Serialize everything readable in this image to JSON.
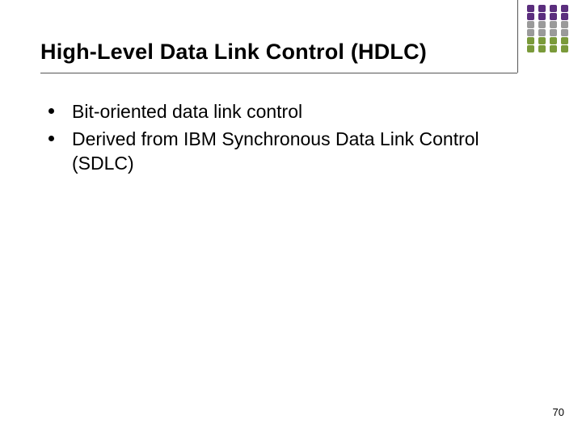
{
  "title": "High-Level Data Link Control (HDLC)",
  "bullets": [
    "Bit-oriented data link control",
    "Derived from IBM Synchronous Data Link Control (SDLC)"
  ],
  "page_number": "70",
  "decor": {
    "dot_colors_by_row": [
      "#5b2e7e",
      "#5b2e7e",
      "#9a9a9a",
      "#9a9a9a",
      "#7a9a3a",
      "#7a9a3a"
    ],
    "rows": 6,
    "cols": 4
  }
}
